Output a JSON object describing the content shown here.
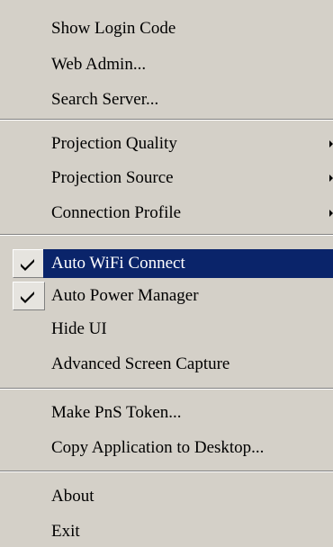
{
  "menu": {
    "group1": [
      {
        "label": "Show Login Code"
      },
      {
        "label": "Web Admin..."
      },
      {
        "label": "Search Server..."
      }
    ],
    "group2": [
      {
        "label": "Projection Quality"
      },
      {
        "label": "Projection Source"
      },
      {
        "label": "Connection Profile"
      }
    ],
    "group3": [
      {
        "label": "Auto WiFi Connect",
        "checked": true,
        "highlighted": true
      },
      {
        "label": "Auto Power Manager",
        "checked": true
      },
      {
        "label": "Hide UI"
      },
      {
        "label": "Advanced Screen Capture"
      }
    ],
    "group4": [
      {
        "label": "Make PnS Token..."
      },
      {
        "label": "Copy Application to Desktop..."
      }
    ],
    "group5": [
      {
        "label": "About"
      },
      {
        "label": "Exit"
      }
    ]
  },
  "colors": {
    "menu_background": "#d4d0c8",
    "highlight": "#0a246a",
    "highlight_text": "#ffffff"
  },
  "icons": {
    "submenu": "submenu-arrow-icon",
    "check": "checkmark-icon"
  }
}
